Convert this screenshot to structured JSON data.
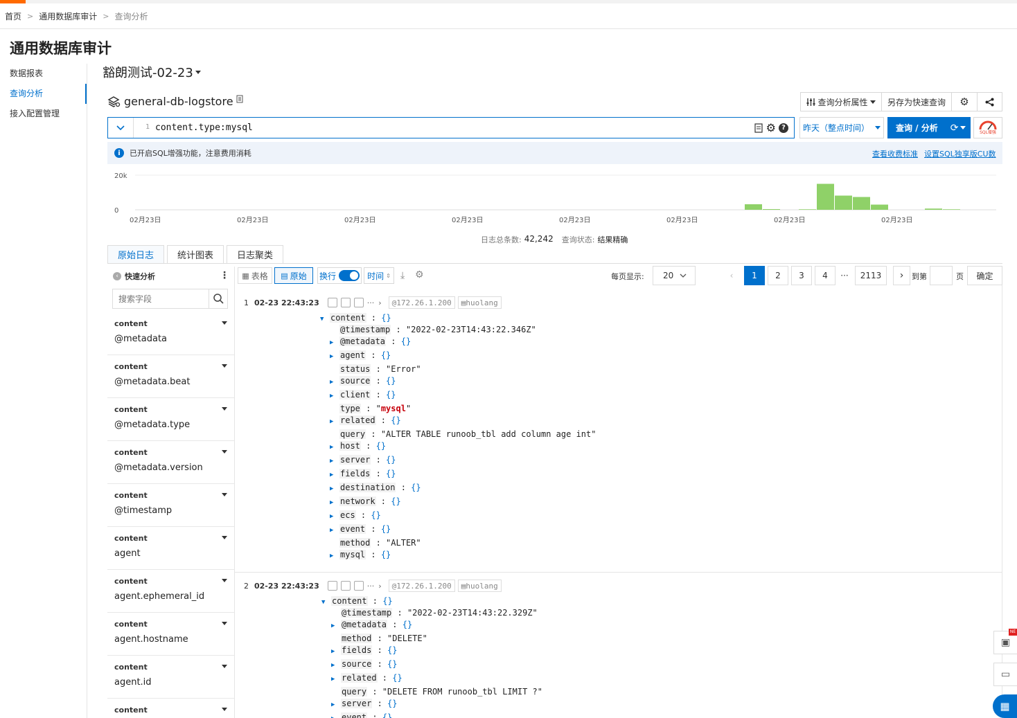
{
  "breadcrumb": {
    "home": "首页",
    "section": "通用数据库审计",
    "current": "查询分析"
  },
  "page_title": "通用数据库审计",
  "leftnav": [
    "数据报表",
    "查询分析",
    "接入配置管理"
  ],
  "project_name": "豁朗测试-02-23",
  "logstore_name": "general-db-logstore",
  "toolbar": {
    "props": "查询分析属性",
    "save_quick": "另存为快速查询"
  },
  "query": {
    "line_no": "1",
    "text": "content.type:mysql"
  },
  "time_range": "昨天（整点时间）",
  "search_btn": "查询 / 分析",
  "sql_badge": "SQL增强",
  "notice": {
    "text": "已开启SQL增强功能，注意费用消耗",
    "link1": "查看收费标准",
    "link2": "设置SQL独享版CU数"
  },
  "chart_data": {
    "type": "bar",
    "y_ticks": [
      "20k",
      "0"
    ],
    "x_ticks": [
      "02月23日",
      "02月23日",
      "02月23日",
      "02月23日",
      "02月23日",
      "02月23日",
      "02月23日",
      "02月23日"
    ],
    "ylim": [
      0,
      20000
    ],
    "values": [
      3200,
      400,
      0,
      300,
      15000,
      8200,
      7400,
      3000,
      0,
      0,
      700,
      300
    ],
    "bar_color": "#8fd168",
    "grid": true
  },
  "summary": {
    "total_label": "日志总条数:",
    "total": "42,242",
    "status_label": "查询状态:",
    "status": "结果精确"
  },
  "tabs": [
    "原始日志",
    "统计图表",
    "日志聚类"
  ],
  "quick_analysis": {
    "title": "快速分析",
    "search_placeholder": "搜索字段"
  },
  "fields": [
    {
      "group": "content",
      "name": "@metadata"
    },
    {
      "group": "content",
      "name": "@metadata.beat"
    },
    {
      "group": "content",
      "name": "@metadata.type"
    },
    {
      "group": "content",
      "name": "@metadata.version"
    },
    {
      "group": "content",
      "name": "@timestamp"
    },
    {
      "group": "content",
      "name": "agent"
    },
    {
      "group": "content",
      "name": "agent.ephemeral_id"
    },
    {
      "group": "content",
      "name": "agent.hostname"
    },
    {
      "group": "content",
      "name": "agent.id"
    },
    {
      "group": "content",
      "name": ""
    }
  ],
  "view": {
    "table": "表格",
    "raw": "原始",
    "wrap": "换行",
    "time": "时间"
  },
  "pager": {
    "page_size_label": "每页显示:",
    "page_size": "20",
    "pages": [
      "1",
      "2",
      "3",
      "4"
    ],
    "ellipsis": "···",
    "last": "2113",
    "goto": "到第",
    "page": "页",
    "confirm": "确定"
  },
  "logs": [
    {
      "index": "1",
      "time": "02-23 22:43:23",
      "ip": "@172.26.1.200",
      "host": "huolang",
      "rows": [
        {
          "k": "content",
          "v": "{}",
          "e": "open",
          "lv": 0
        },
        {
          "k": "@timestamp",
          "v": "\"2022-02-23T14:43:22.346Z\"",
          "e": "",
          "lv": 1
        },
        {
          "k": "@metadata",
          "v": "{}",
          "e": "closed",
          "lv": 1
        },
        {
          "k": "agent",
          "v": "{}",
          "e": "closed",
          "lv": 1
        },
        {
          "k": "status",
          "v": "\"Error\"",
          "e": "",
          "lv": 1
        },
        {
          "k": "source",
          "v": "{}",
          "e": "closed",
          "lv": 1
        },
        {
          "k": "client",
          "v": "{}",
          "e": "closed",
          "lv": 1
        },
        {
          "k": "type",
          "v": "mysql",
          "e": "hl",
          "lv": 1
        },
        {
          "k": "related",
          "v": "{}",
          "e": "closed",
          "lv": 1
        },
        {
          "k": "query",
          "v": "\"ALTER TABLE runoob_tbl add column age int\"",
          "e": "",
          "lv": 1
        },
        {
          "k": "host",
          "v": "{}",
          "e": "closed",
          "lv": 1
        },
        {
          "k": "server",
          "v": "{}",
          "e": "closed",
          "lv": 1
        },
        {
          "k": "fields",
          "v": "{}",
          "e": "closed",
          "lv": 1
        },
        {
          "k": "destination",
          "v": "{}",
          "e": "closed",
          "lv": 1
        },
        {
          "k": "network",
          "v": "{}",
          "e": "closed",
          "lv": 1
        },
        {
          "k": "ecs",
          "v": "{}",
          "e": "closed",
          "lv": 1
        },
        {
          "k": "event",
          "v": "{}",
          "e": "closed",
          "lv": 1
        },
        {
          "k": "method",
          "v": "\"ALTER\"",
          "e": "",
          "lv": 1
        },
        {
          "k": "mysql",
          "v": "{}",
          "e": "closed",
          "lv": 1
        }
      ]
    },
    {
      "index": "2",
      "time": "02-23 22:43:23",
      "ip": "@172.26.1.200",
      "host": "huolang",
      "rows": [
        {
          "k": "content",
          "v": "{}",
          "e": "open",
          "lv": 0
        },
        {
          "k": "@timestamp",
          "v": "\"2022-02-23T14:43:22.329Z\"",
          "e": "",
          "lv": 1
        },
        {
          "k": "@metadata",
          "v": "{}",
          "e": "closed",
          "lv": 1
        },
        {
          "k": "method",
          "v": "\"DELETE\"",
          "e": "",
          "lv": 1
        },
        {
          "k": "fields",
          "v": "{}",
          "e": "closed",
          "lv": 1
        },
        {
          "k": "source",
          "v": "{}",
          "e": "closed",
          "lv": 1
        },
        {
          "k": "related",
          "v": "{}",
          "e": "closed",
          "lv": 1
        },
        {
          "k": "query",
          "v": "\"DELETE FROM runoob_tbl LIMIT ?\"",
          "e": "",
          "lv": 1
        },
        {
          "k": "server",
          "v": "{}",
          "e": "closed",
          "lv": 1
        },
        {
          "k": "event",
          "v": "{}",
          "e": "closed",
          "lv": 1
        }
      ]
    }
  ]
}
